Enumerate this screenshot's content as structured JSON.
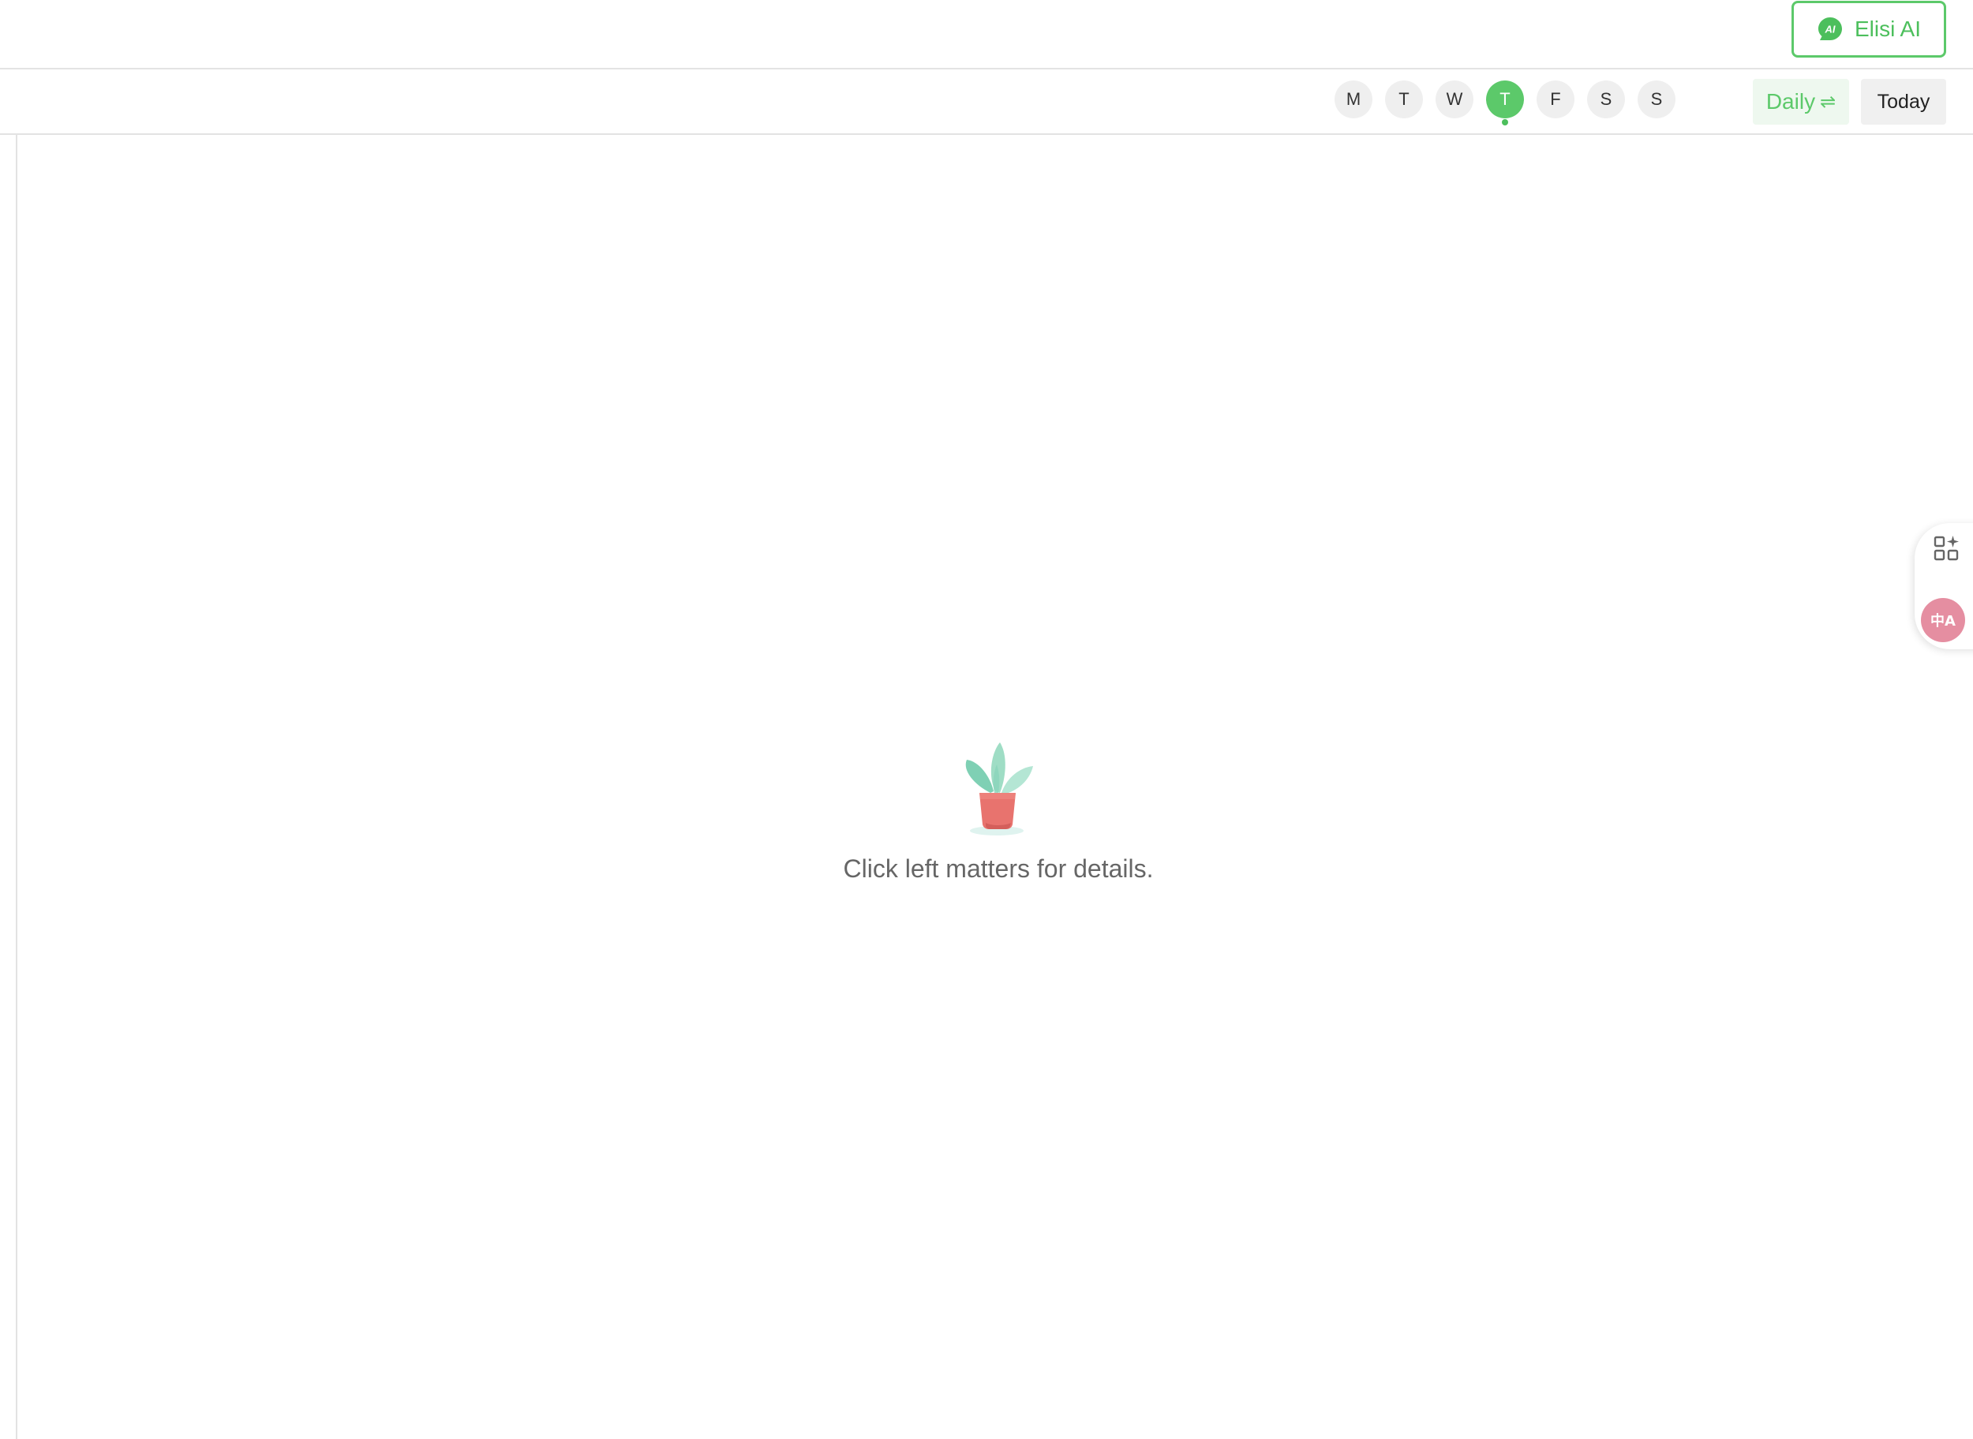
{
  "header": {
    "ai_button_label": "Elisi AI",
    "ai_badge_text": "AI"
  },
  "week_days": [
    {
      "label": "M",
      "active": false
    },
    {
      "label": "T",
      "active": false
    },
    {
      "label": "W",
      "active": false
    },
    {
      "label": "T",
      "active": true
    },
    {
      "label": "F",
      "active": false
    },
    {
      "label": "S",
      "active": false
    },
    {
      "label": "S",
      "active": false
    }
  ],
  "toolbar": {
    "view_label": "Daily",
    "view_swap_icon": "⇌",
    "today_label": "Today"
  },
  "empty_state": {
    "message": "Click left matters for details.",
    "icon": "potted-plant-icon"
  },
  "floating_tools": {
    "apps_icon": "apps-sparkle-icon",
    "translate_icon": "translate-icon",
    "translate_text": "中A"
  },
  "colors": {
    "accent": "#5cc96a",
    "translate": "#e58ea1"
  }
}
